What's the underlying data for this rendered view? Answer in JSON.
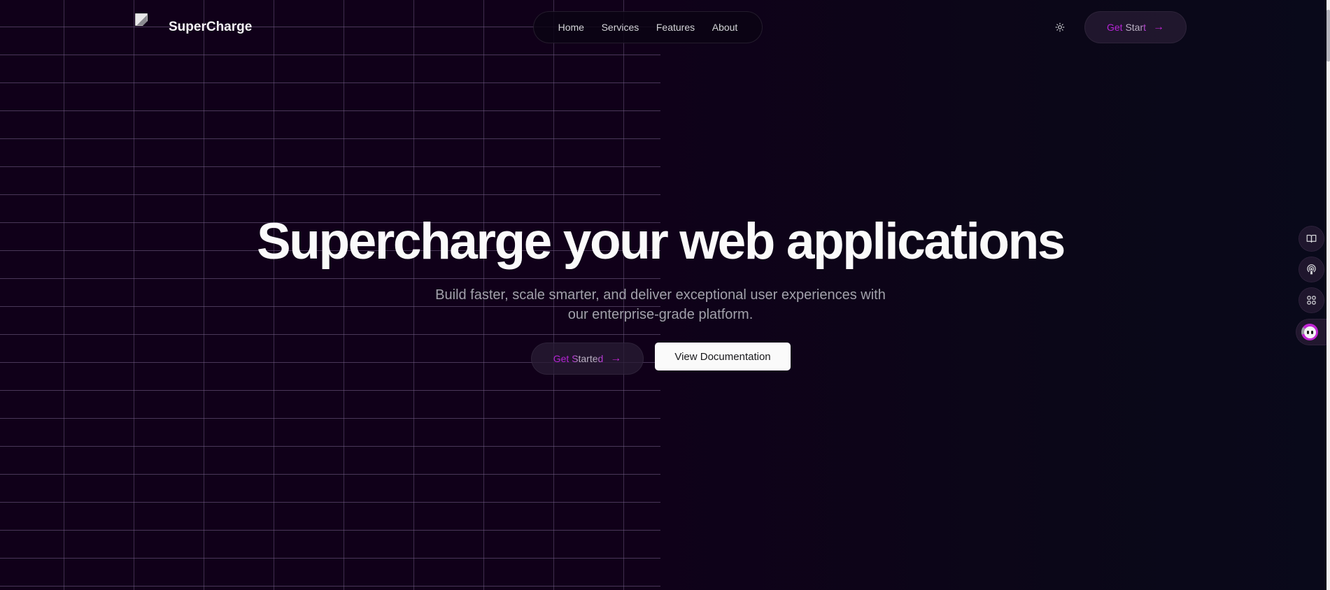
{
  "brand": {
    "name": "SuperCharge",
    "logo_alt_icon": "broken-image-icon"
  },
  "nav": {
    "items": [
      {
        "label": "Home"
      },
      {
        "label": "Services"
      },
      {
        "label": "Features"
      },
      {
        "label": "About"
      }
    ]
  },
  "header": {
    "theme_toggle_icon": "sun-icon",
    "cta_label": "Get Start",
    "cta_icon": "arrow-right-icon",
    "arrow_glyph": "→"
  },
  "hero": {
    "title": "Supercharge your web applications",
    "subtitle": "Build faster, scale smarter, and deliver exceptional user experiences with our enterprise-grade platform.",
    "primary_cta": "Get Started",
    "secondary_cta": "View Documentation"
  },
  "side_dock": {
    "items": [
      {
        "icon": "book-icon"
      },
      {
        "icon": "podcast-icon"
      },
      {
        "icon": "apps-grid-icon"
      },
      {
        "icon": "chatbot-icon"
      }
    ]
  },
  "colors": {
    "accent": "#c026d3",
    "background": "#100019",
    "text": "#fafafa",
    "muted": "#a1a1aa"
  }
}
